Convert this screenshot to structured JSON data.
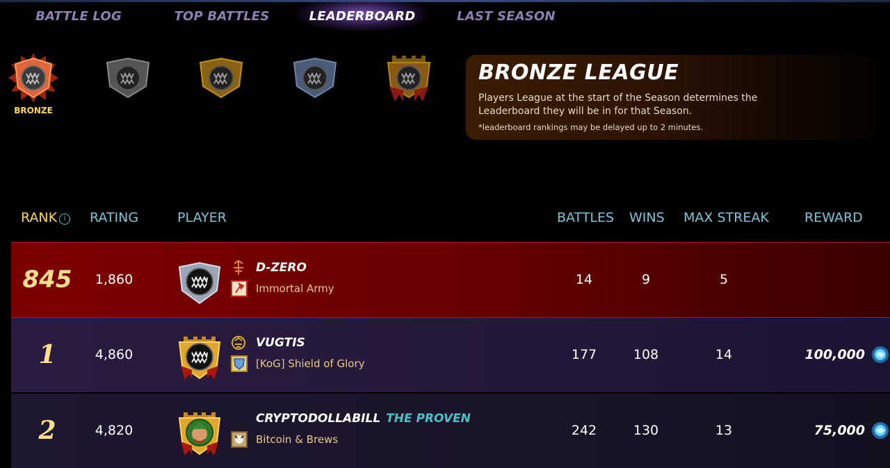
{
  "tabs": [
    {
      "label": "BATTLE LOG"
    },
    {
      "label": "TOP BATTLES"
    },
    {
      "label": "LEADERBOARD",
      "active": true
    },
    {
      "label": "LAST SEASON"
    }
  ],
  "leagues": {
    "selected_label": "BRONZE",
    "items": [
      {
        "name": "bronze-league-icon",
        "color": "#d25a2a"
      },
      {
        "name": "silver-league-icon",
        "color": "#8c8c8c"
      },
      {
        "name": "gold-league-icon",
        "color": "#d8a22a"
      },
      {
        "name": "diamond-league-icon",
        "color": "#6f86a8"
      },
      {
        "name": "champion-league-icon",
        "color": "#c0391b"
      }
    ]
  },
  "info": {
    "title": "BRONZE LEAGUE",
    "description": "Players League at the start of the Season determines the Leaderboard they will be in for that Season.",
    "note": "*leaderboard rankings may be delayed up to 2 minutes."
  },
  "headers": {
    "rank": "RANK",
    "rank_info_icon": "i",
    "rating": "RATING",
    "player": "PLAYER",
    "battles": "BATTLES",
    "wins": "WINS",
    "max_streak": "MAX STREAK",
    "reward": "REWARD"
  },
  "rows": [
    {
      "rank": "845",
      "rating": "1,860",
      "player": "D-ZERO",
      "title": "",
      "guild": "Immortal Army",
      "battles": "14",
      "wins": "9",
      "max_streak": "5",
      "reward": ""
    },
    {
      "rank": "1",
      "rating": "4,860",
      "player": "VUGTIS",
      "title": "",
      "guild": "[KoG] Shield of Glory",
      "battles": "177",
      "wins": "108",
      "max_streak": "14",
      "reward": "100,000"
    },
    {
      "rank": "2",
      "rating": "4,820",
      "player": "CRYPTODOLLABILL",
      "title": "THE PROVEN",
      "guild": "Bitcoin & Brews",
      "battles": "242",
      "wins": "130",
      "max_streak": "13",
      "reward": "75,000"
    }
  ],
  "colors": {
    "accent_gold": "#ffd75e",
    "accent_teal": "#7fc3d8",
    "title_teal": "#48c1c9",
    "my_row": "#7d0000"
  }
}
